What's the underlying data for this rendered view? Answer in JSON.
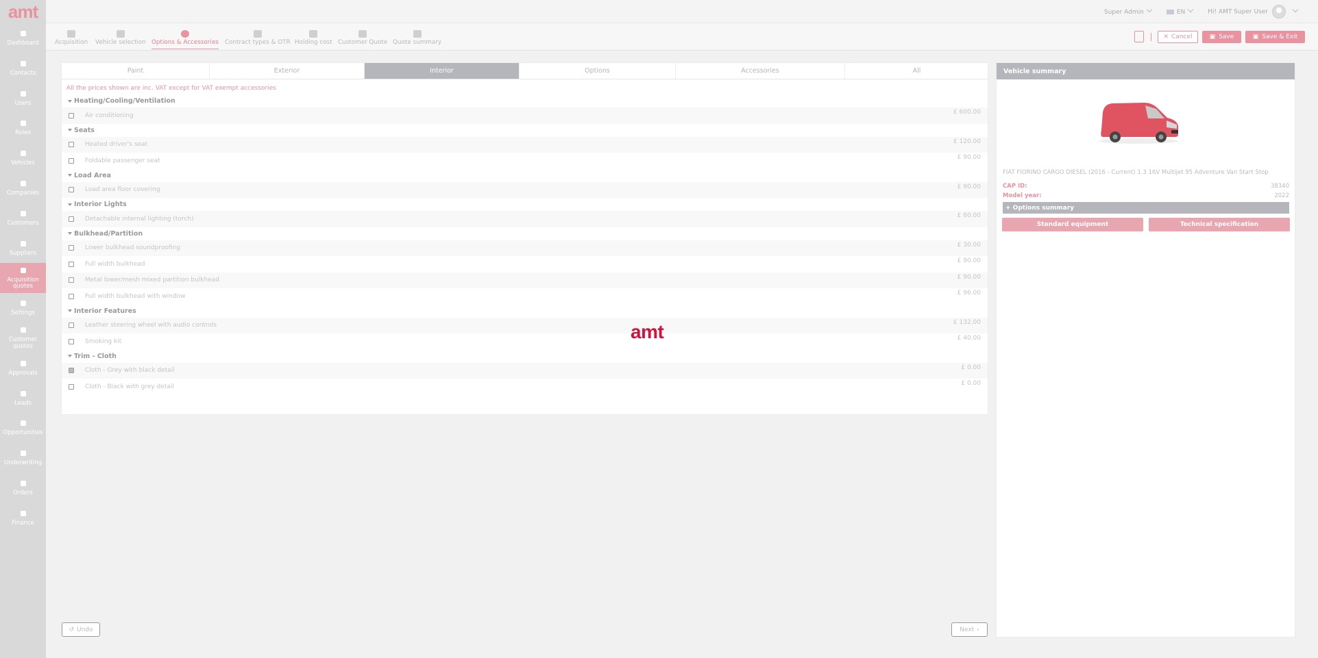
{
  "brand": {
    "logo_text": "amt",
    "accent": "#e8939f",
    "loader_color": "#d1123f"
  },
  "sidebar": {
    "items": [
      {
        "label": "Dashboard",
        "icon": "dashboard-icon"
      },
      {
        "label": "Contacts",
        "icon": "contacts-icon"
      },
      {
        "label": "Users",
        "icon": "user-icon"
      },
      {
        "label": "Roles",
        "icon": "roles-icon"
      },
      {
        "label": "Vehicles",
        "icon": "car-icon"
      },
      {
        "label": "Companies",
        "icon": "companies-icon"
      },
      {
        "label": "Customers",
        "icon": "customers-icon"
      },
      {
        "label": "Suppliers",
        "icon": "suppliers-icon"
      },
      {
        "label": "Acquisition quotes",
        "icon": "document-icon",
        "active": true
      },
      {
        "label": "Settings",
        "icon": "gear-icon"
      },
      {
        "label": "Customer quotes",
        "icon": "customer-quotes-icon"
      },
      {
        "label": "Approvals",
        "icon": "check-circle-icon"
      },
      {
        "label": "Leads",
        "icon": "leads-icon"
      },
      {
        "label": "Opportunities",
        "icon": "opportunities-icon"
      },
      {
        "label": "Underwriting",
        "icon": "underwriting-icon"
      },
      {
        "label": "Orders",
        "icon": "cart-icon"
      },
      {
        "label": "Finance",
        "icon": "pound-icon"
      }
    ]
  },
  "topbar": {
    "role": "Super Admin",
    "language": "EN",
    "greeting": "Hi! AMT Super User"
  },
  "steps": [
    {
      "label": "Acquisition"
    },
    {
      "label": "Vehicle selection"
    },
    {
      "label": "Options & Accessories",
      "active": true
    },
    {
      "label": "Contract types & OTR"
    },
    {
      "label": "Holding cost"
    },
    {
      "label": "Customer Quote"
    },
    {
      "label": "Quote summary"
    }
  ],
  "actions": {
    "cancel": "Cancel",
    "save": "Save",
    "save_exit": "Save & Exit"
  },
  "tabs": [
    "Paint",
    "Exterior",
    "Interior",
    "Options",
    "Accessories",
    "All"
  ],
  "active_tab": "Interior",
  "vat_note": "All the prices shown are inc. VAT except for VAT exempt accessories",
  "groups": [
    {
      "title": "Heating/Cooling/Ventilation",
      "options": [
        {
          "label": "Air conditioning",
          "price": "£ 600.00",
          "checked": false
        }
      ]
    },
    {
      "title": "Seats",
      "options": [
        {
          "label": "Heated driver's seat",
          "price": "£ 120.00",
          "checked": false
        },
        {
          "label": "Foldable passenger seat",
          "price": "£ 90.00",
          "checked": false
        }
      ]
    },
    {
      "title": "Load Area",
      "options": [
        {
          "label": "Load area floor covering",
          "price": "£ 90.00",
          "checked": false
        }
      ]
    },
    {
      "title": "Interior Lights",
      "options": [
        {
          "label": "Detachable internal lighting (torch)",
          "price": "£ 60.00",
          "checked": false
        }
      ]
    },
    {
      "title": "Bulkhead/Partition",
      "options": [
        {
          "label": "Lower bulkhead soundproofing",
          "price": "£ 30.00",
          "checked": false
        },
        {
          "label": "Full width bulkhead",
          "price": "£ 90.00",
          "checked": false
        },
        {
          "label": "Metal lower/mesh mixed partition bulkhead",
          "price": "£ 90.00",
          "checked": false
        },
        {
          "label": "Full width bulkhead with window",
          "price": "£ 96.00",
          "checked": false
        }
      ]
    },
    {
      "title": "Interior Features",
      "options": [
        {
          "label": "Leather steering wheel with audio controls",
          "price": "£ 132.00",
          "checked": false
        },
        {
          "label": "Smoking kit",
          "price": "£ 40.00",
          "checked": false
        }
      ]
    },
    {
      "title": "Trim - Cloth",
      "options": [
        {
          "label": "Cloth - Grey with black detail",
          "price": "£ 0.00",
          "checked": true
        },
        {
          "label": "Cloth - Black with grey detail",
          "price": "£ 0.00",
          "checked": false
        }
      ]
    }
  ],
  "summary": {
    "title": "Vehicle summary",
    "vehicle": "FIAT FIORINO CARGO DIESEL (2016 - Current) 1.3 16V Multijet 95 Adventure Van Start Stop",
    "cap_id_label": "CAP ID:",
    "cap_id": "38340",
    "model_year_label": "Model year:",
    "model_year": "2022",
    "options_summary": "+ Options summary",
    "standard_equipment": "Standard equipment",
    "technical_spec": "Technical specification"
  },
  "footer": {
    "undo": "Undo",
    "next": "Next"
  },
  "loader_text": "amt"
}
